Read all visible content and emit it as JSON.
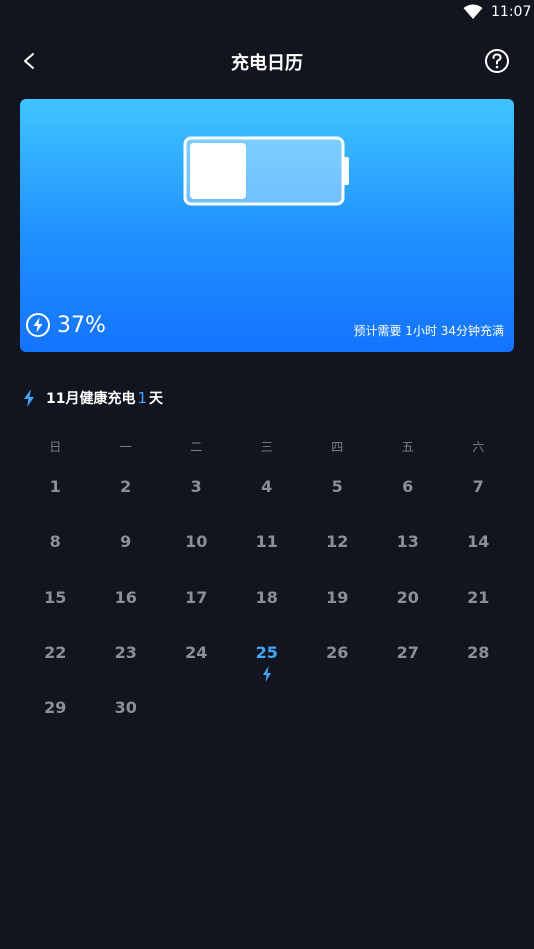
{
  "status_bar": {
    "time": "11:07"
  },
  "header": {
    "title": "充电日历"
  },
  "battery": {
    "percent_text": "37%",
    "level_fraction": 0.37,
    "time_remaining": "预计需要 1小时 34分钟充满"
  },
  "summary": {
    "prefix": "11月健康充电",
    "count": "1",
    "suffix": "天"
  },
  "calendar": {
    "weekdays": [
      "日",
      "一",
      "二",
      "三",
      "四",
      "五",
      "六"
    ],
    "days": [
      {
        "n": "1"
      },
      {
        "n": "2"
      },
      {
        "n": "3"
      },
      {
        "n": "4"
      },
      {
        "n": "5"
      },
      {
        "n": "6"
      },
      {
        "n": "7"
      },
      {
        "n": "8"
      },
      {
        "n": "9"
      },
      {
        "n": "10"
      },
      {
        "n": "11"
      },
      {
        "n": "12"
      },
      {
        "n": "13"
      },
      {
        "n": "14"
      },
      {
        "n": "15"
      },
      {
        "n": "16"
      },
      {
        "n": "17"
      },
      {
        "n": "18"
      },
      {
        "n": "19"
      },
      {
        "n": "20"
      },
      {
        "n": "21"
      },
      {
        "n": "22"
      },
      {
        "n": "23"
      },
      {
        "n": "24"
      },
      {
        "n": "25",
        "today": true,
        "charged": true
      },
      {
        "n": "26"
      },
      {
        "n": "27"
      },
      {
        "n": "28"
      },
      {
        "n": "29"
      },
      {
        "n": "30"
      }
    ]
  },
  "colors": {
    "background": "#12151f",
    "accent": "#3ea7ff",
    "card_top": "#3fc4ff",
    "card_bottom": "#1473ff"
  }
}
